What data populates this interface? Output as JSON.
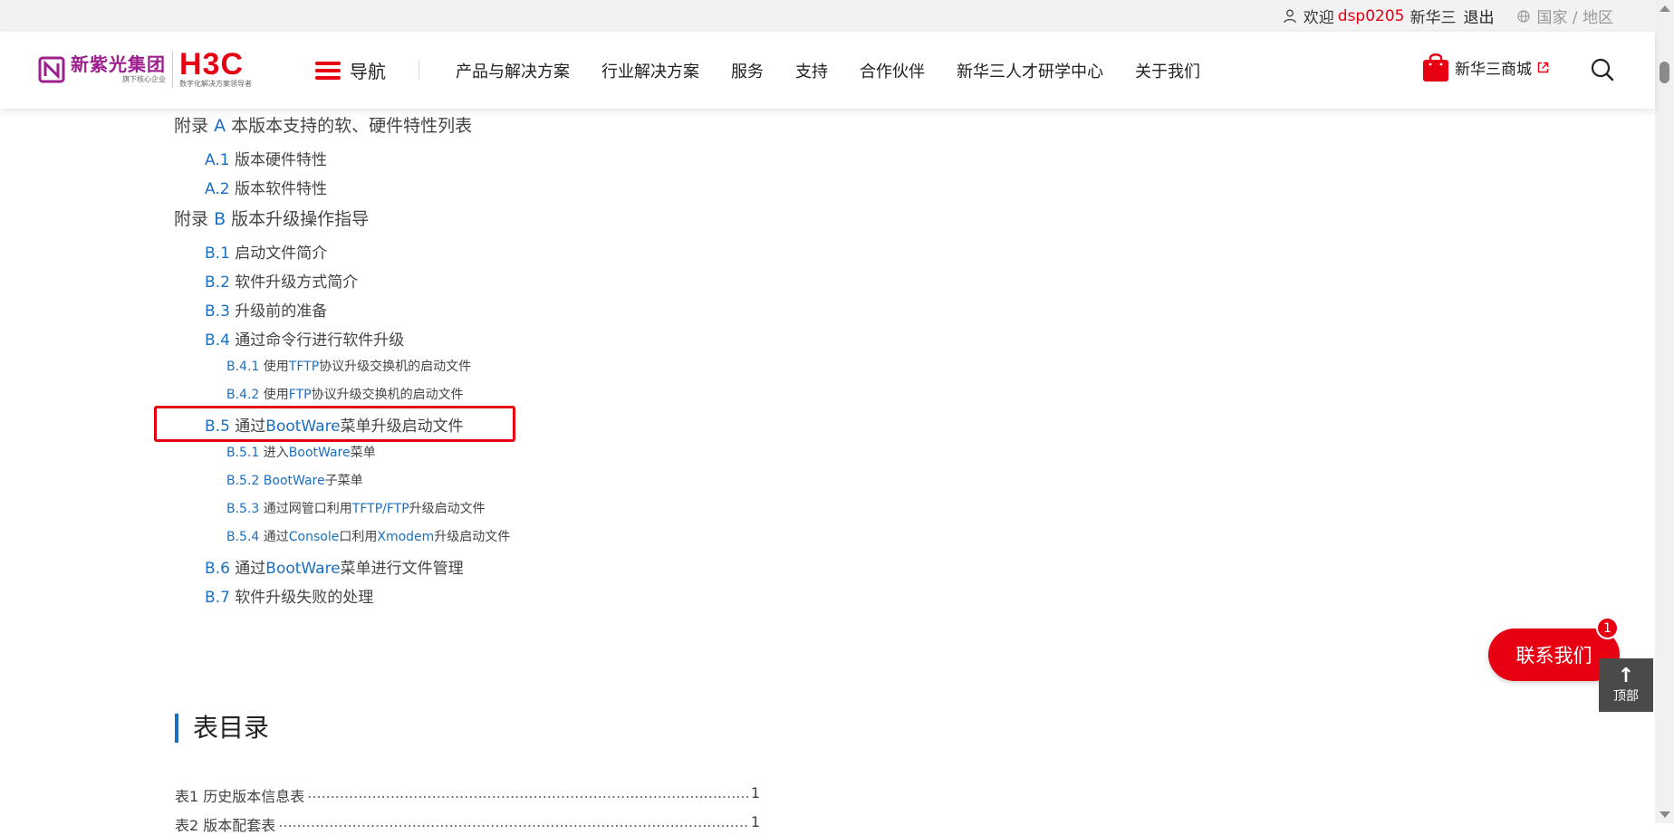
{
  "topbar": {
    "welcome": "欢迎",
    "username": "dsp0205",
    "company": "新华三",
    "logout": "退出",
    "region": "国家 / 地区"
  },
  "logo": {
    "unis_cn": "新紫光集团",
    "unis_sub": "旗下核心企业",
    "h3c": "H3C",
    "h3c_sub": "数字化解决方案领导者"
  },
  "nav": {
    "toggle_label": "导航",
    "links": [
      "产品与解决方案",
      "行业解决方案",
      "服务",
      "支持",
      "合作伙伴",
      "新华三人才研学中心",
      "关于我们"
    ],
    "shop_label": "新华三商城"
  },
  "toc": {
    "appA": {
      "prefix": "附录",
      "num": "A",
      "text": "本版本支持的软、硬件特性列表"
    },
    "a1": {
      "num": "A.1",
      "text": "版本硬件特性"
    },
    "a2": {
      "num": "A.2",
      "text": "版本软件特性"
    },
    "appB": {
      "prefix": "附录",
      "num": "B",
      "text": "版本升级操作指导"
    },
    "b1": {
      "num": "B.1",
      "text": "启动文件简介"
    },
    "b2": {
      "num": "B.2",
      "text": "软件升级方式简介"
    },
    "b3": {
      "num": "B.3",
      "text": "升级前的准备"
    },
    "b4": {
      "num": "B.4",
      "text": "通过命令行进行软件升级"
    },
    "b41": {
      "num": "B.4.1",
      "pre": "使用",
      "en": "TFTP",
      "post": "协议升级交换机的启动文件"
    },
    "b42": {
      "num": "B.4.2",
      "pre": "使用",
      "en": "FTP",
      "post": "协议升级交换机的启动文件"
    },
    "b5": {
      "num": "B.5",
      "pre": "通过",
      "en": "BootWare",
      "post": "菜单升级启动文件"
    },
    "b51": {
      "num": "B.5.1",
      "pre": "进入",
      "en": "BootWare",
      "post": "菜单"
    },
    "b52": {
      "num": "B.5.2",
      "pre": "",
      "en": "BootWare",
      "post": "子菜单"
    },
    "b53": {
      "num": "B.5.3",
      "pre": "通过网管口利用",
      "en": "TFTP/FTP",
      "post": "升级启动文件"
    },
    "b54": {
      "num": "B.5.4",
      "pre": "通过",
      "en": "Console",
      "mid": "口利用",
      "en2": "Xmodem",
      "post": "升级启动文件"
    },
    "b6": {
      "num": "B.6",
      "pre": "通过",
      "en": "BootWare",
      "post": "菜单进行文件管理"
    },
    "b7": {
      "num": "B.7",
      "text": "软件升级失败的处理"
    }
  },
  "tables_section": {
    "title": "表目录",
    "rows": [
      {
        "label": "表1 历史版本信息表",
        "page": "1"
      },
      {
        "label": "表2 版本配套表",
        "page": "1"
      }
    ]
  },
  "widgets": {
    "contact": "联系我们",
    "badge": "1",
    "top_arrow": "↑",
    "top_label": "顶部"
  },
  "colors": {
    "brand_red": "#e60012",
    "link_blue": "#1a6fc1",
    "unis_purple": "#9d1f8e"
  }
}
